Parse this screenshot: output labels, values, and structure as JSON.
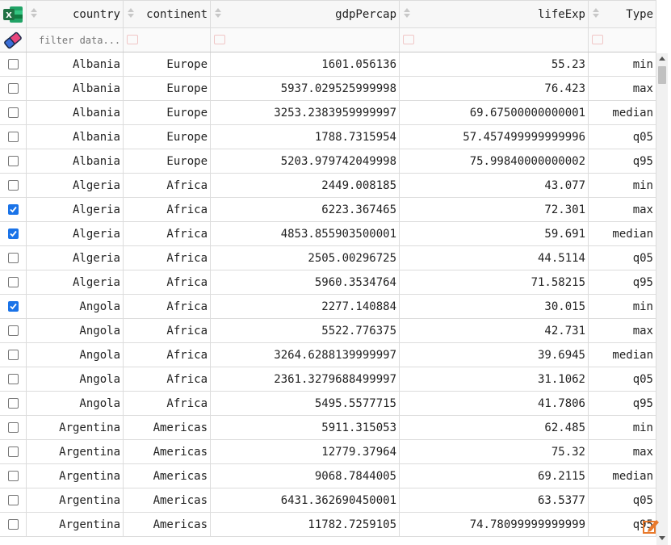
{
  "columns": [
    "country",
    "continent",
    "gdpPercap",
    "lifeExp",
    "Type"
  ],
  "filter": {
    "placeholder": "filter data..."
  },
  "icons": {
    "excel": "excel-export-icon",
    "clear": "eraser-icon",
    "edit": "edit-icon"
  },
  "colors": {
    "checked": "#1a73e8",
    "excel_green": "#1f7244",
    "edit_orange": "#e8792b"
  },
  "rows": [
    {
      "checked": false,
      "country": "Albania",
      "continent": "Europe",
      "gdpPercap": "1601.056136",
      "lifeExp": "55.23",
      "type": "min"
    },
    {
      "checked": false,
      "country": "Albania",
      "continent": "Europe",
      "gdpPercap": "5937.029525999998",
      "lifeExp": "76.423",
      "type": "max"
    },
    {
      "checked": false,
      "country": "Albania",
      "continent": "Europe",
      "gdpPercap": "3253.2383959999997",
      "lifeExp": "69.67500000000001",
      "type": "median"
    },
    {
      "checked": false,
      "country": "Albania",
      "continent": "Europe",
      "gdpPercap": "1788.7315954",
      "lifeExp": "57.457499999999996",
      "type": "q05"
    },
    {
      "checked": false,
      "country": "Albania",
      "continent": "Europe",
      "gdpPercap": "5203.979742049998",
      "lifeExp": "75.99840000000002",
      "type": "q95"
    },
    {
      "checked": false,
      "country": "Algeria",
      "continent": "Africa",
      "gdpPercap": "2449.008185",
      "lifeExp": "43.077",
      "type": "min"
    },
    {
      "checked": true,
      "country": "Algeria",
      "continent": "Africa",
      "gdpPercap": "6223.367465",
      "lifeExp": "72.301",
      "type": "max"
    },
    {
      "checked": true,
      "country": "Algeria",
      "continent": "Africa",
      "gdpPercap": "4853.855903500001",
      "lifeExp": "59.691",
      "type": "median"
    },
    {
      "checked": false,
      "country": "Algeria",
      "continent": "Africa",
      "gdpPercap": "2505.00296725",
      "lifeExp": "44.5114",
      "type": "q05"
    },
    {
      "checked": false,
      "country": "Algeria",
      "continent": "Africa",
      "gdpPercap": "5960.3534764",
      "lifeExp": "71.58215",
      "type": "q95"
    },
    {
      "checked": true,
      "country": "Angola",
      "continent": "Africa",
      "gdpPercap": "2277.140884",
      "lifeExp": "30.015",
      "type": "min"
    },
    {
      "checked": false,
      "country": "Angola",
      "continent": "Africa",
      "gdpPercap": "5522.776375",
      "lifeExp": "42.731",
      "type": "max"
    },
    {
      "checked": false,
      "country": "Angola",
      "continent": "Africa",
      "gdpPercap": "3264.6288139999997",
      "lifeExp": "39.6945",
      "type": "median"
    },
    {
      "checked": false,
      "country": "Angola",
      "continent": "Africa",
      "gdpPercap": "2361.3279688499997",
      "lifeExp": "31.1062",
      "type": "q05"
    },
    {
      "checked": false,
      "country": "Angola",
      "continent": "Africa",
      "gdpPercap": "5495.5577715",
      "lifeExp": "41.7806",
      "type": "q95"
    },
    {
      "checked": false,
      "country": "Argentina",
      "continent": "Americas",
      "gdpPercap": "5911.315053",
      "lifeExp": "62.485",
      "type": "min"
    },
    {
      "checked": false,
      "country": "Argentina",
      "continent": "Americas",
      "gdpPercap": "12779.37964",
      "lifeExp": "75.32",
      "type": "max"
    },
    {
      "checked": false,
      "country": "Argentina",
      "continent": "Americas",
      "gdpPercap": "9068.7844005",
      "lifeExp": "69.2115",
      "type": "median"
    },
    {
      "checked": false,
      "country": "Argentina",
      "continent": "Americas",
      "gdpPercap": "6431.362690450001",
      "lifeExp": "63.5377",
      "type": "q05"
    },
    {
      "checked": false,
      "country": "Argentina",
      "continent": "Americas",
      "gdpPercap": "11782.7259105",
      "lifeExp": "74.78099999999999",
      "type": "q95"
    }
  ]
}
